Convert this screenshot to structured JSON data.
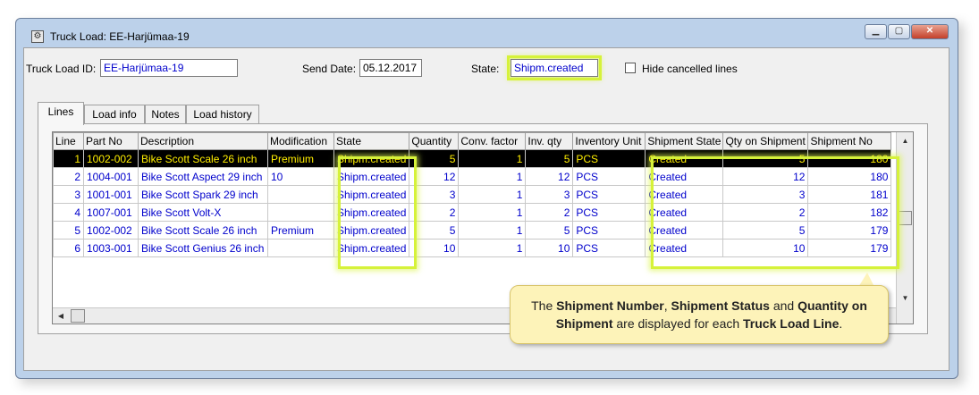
{
  "window": {
    "title": "Truck Load: EE-Harjümaa-19",
    "icon": "settings-app-icon",
    "buttons": {
      "minimize": "▁",
      "maximize": "▢",
      "close": "✕"
    }
  },
  "header": {
    "truck_load_id_label": "Truck Load ID:",
    "truck_load_id": "EE-Harjümaa-19",
    "send_date_label": "Send Date:",
    "send_date": "05.12.2017",
    "state_label": "State:",
    "state": "Shipm.created",
    "hide_cancelled_label": "Hide cancelled lines"
  },
  "tabs": [
    "Lines",
    "Load info",
    "Notes",
    "Load history"
  ],
  "table": {
    "columns": [
      "Line",
      "Part No",
      "Description",
      "Modification",
      "State",
      "Quantity",
      "Conv. factor",
      "Inv. qty",
      "Inventory Unit",
      "Shipment State",
      "Qty on Shipment",
      "Shipment No"
    ],
    "rows": [
      [
        "1",
        "1002-002",
        "Bike Scott Scale 26 inch",
        "Premium",
        "Shipm.created",
        "5",
        "1",
        "5",
        "PCS",
        "Created",
        "5",
        "180"
      ],
      [
        "2",
        "1004-001",
        "Bike Scott Aspect 29 inch",
        "10",
        "Shipm.created",
        "12",
        "1",
        "12",
        "PCS",
        "Created",
        "12",
        "180"
      ],
      [
        "3",
        "1001-001",
        "Bike Scott Spark 29 inch",
        "",
        "Shipm.created",
        "3",
        "1",
        "3",
        "PCS",
        "Created",
        "3",
        "181"
      ],
      [
        "4",
        "1007-001",
        "Bike Scott Volt-X",
        "",
        "Shipm.created",
        "2",
        "1",
        "2",
        "PCS",
        "Created",
        "2",
        "182"
      ],
      [
        "5",
        "1002-002",
        "Bike Scott Scale 26 inch",
        "Premium",
        "Shipm.created",
        "5",
        "1",
        "5",
        "PCS",
        "Created",
        "5",
        "179"
      ],
      [
        "6",
        "1003-001",
        "Bike Scott Genius 26 inch",
        "",
        "Shipm.created",
        "10",
        "1",
        "10",
        "PCS",
        "Created",
        "10",
        "179"
      ]
    ]
  },
  "callout": {
    "part1": "The ",
    "b1": "Shipment Number",
    "part2": ", ",
    "b2": "Shipment Status",
    "part3": " and ",
    "b3": "Quantity on Shipment",
    "part4": " are displayed for each ",
    "b4": "Truck Load Line",
    "part5": "."
  },
  "colors": {
    "highlight": "#d6f23a",
    "value_text": "#0000cc",
    "selected_row_bg": "#000000",
    "selected_row_text": "#ffee00",
    "callout_bg": "#fdf3b9"
  }
}
